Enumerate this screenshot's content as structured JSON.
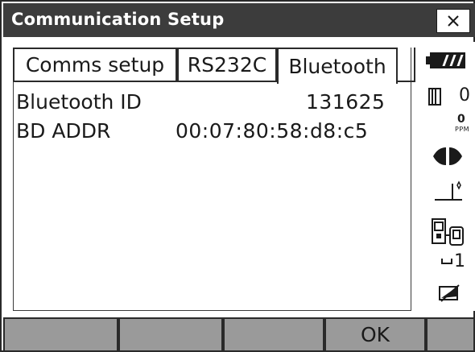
{
  "window": {
    "title": "Communication Setup",
    "close_label": "×"
  },
  "tabs": [
    {
      "label": "Comms setup",
      "selected": false
    },
    {
      "label": "RS232C",
      "selected": false
    },
    {
      "label": "Bluetooth",
      "selected": true
    }
  ],
  "fields": [
    {
      "label": "Bluetooth ID",
      "value": "131625"
    },
    {
      "label": "BD ADDR",
      "value": "00:07:80:58:d8:c5"
    }
  ],
  "status": {
    "prism_constant": "0",
    "ppm_value": "0",
    "ppm_label": "PPM",
    "face_value": "1",
    "icons": [
      "battery-icon",
      "prism-icon",
      "laser-icon",
      "tilt-icon",
      "communication-icon",
      "face-icon",
      "input-mode-icon"
    ]
  },
  "softkeys": [
    "",
    "",
    "",
    "OK",
    ""
  ],
  "colors": {
    "titlebar": "#3c3c3c",
    "softkey_bg": "#9a9a9a",
    "text": "#1a1a1a"
  }
}
